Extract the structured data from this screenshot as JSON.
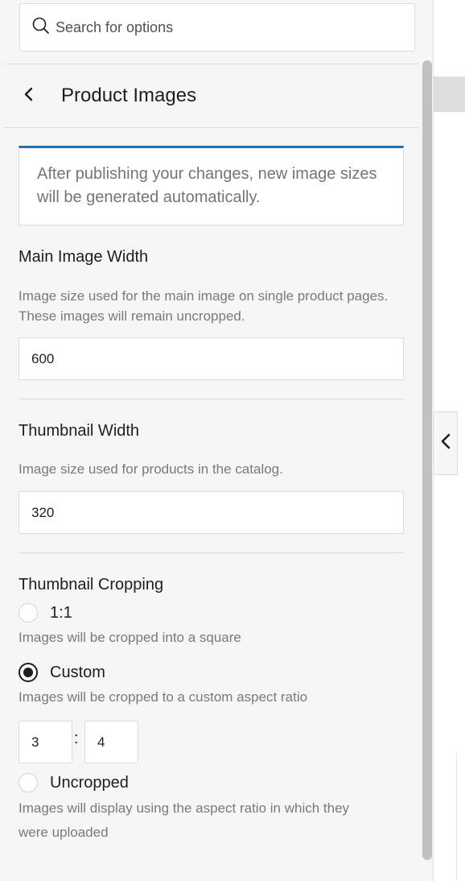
{
  "search": {
    "placeholder": "Search for options"
  },
  "header": {
    "title": "Product Images"
  },
  "notice": {
    "text": "After publishing your changes, new image sizes will be generated automatically."
  },
  "main_image_width": {
    "label": "Main Image Width",
    "description": "Image size used for the main image on single product pages. These images will remain uncropped.",
    "value": "600"
  },
  "thumbnail_width": {
    "label": "Thumbnail Width",
    "description": "Image size used for products in the catalog.",
    "value": "320"
  },
  "thumbnail_cropping": {
    "label": "Thumbnail Cropping",
    "options": [
      {
        "label": "1:1",
        "description": "Images will be cropped into a square",
        "checked": false
      },
      {
        "label": "Custom",
        "description": "Images will be cropped to a custom aspect ratio",
        "checked": true
      },
      {
        "label": "Uncropped",
        "description": "Images will display using the aspect ratio in which they were uploaded",
        "checked": false
      }
    ],
    "custom_ratio": {
      "width": "3",
      "separator": ":",
      "height": "4"
    }
  },
  "icons": {
    "search": "search-icon",
    "back": "chevron-left-icon",
    "collapse": "chevron-left-icon"
  },
  "colors": {
    "accent": "#2271b1"
  }
}
